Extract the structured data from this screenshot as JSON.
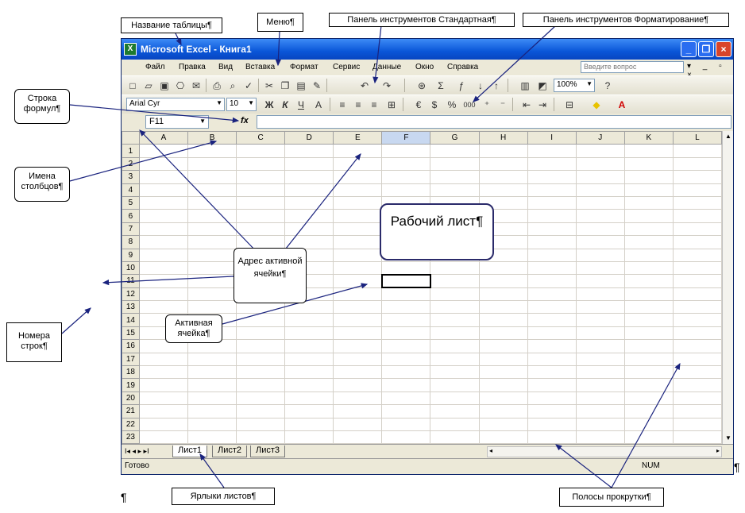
{
  "window": {
    "title": "Microsoft Excel - Книга1",
    "app_icon": "X",
    "min_label": "_",
    "max_label": "❐",
    "close_label": "×"
  },
  "menu": {
    "items": [
      "Файл",
      "Правка",
      "Вид",
      "Вставка",
      "Формат",
      "Сервис",
      "Данные",
      "Окно",
      "Справка"
    ],
    "help_placeholder": "Введите вопрос",
    "right_controls": "▾ _ ▫ ×"
  },
  "toolbar_standard": {
    "zoom": "100%"
  },
  "toolbar_format": {
    "font": "Arial Cyr",
    "size": "10",
    "bold": "Ж",
    "italic": "К",
    "underline": "Ч",
    "percent": "%",
    "thousands": "000"
  },
  "formula_bar": {
    "name_box": "F11",
    "fx": "fx",
    "value": ""
  },
  "sheet": {
    "columns": [
      "A",
      "B",
      "C",
      "D",
      "E",
      "F",
      "G",
      "H",
      "I",
      "J",
      "K",
      "L"
    ],
    "rows": [
      "1",
      "2",
      "3",
      "4",
      "5",
      "6",
      "7",
      "8",
      "9",
      "10",
      "11",
      "12",
      "13",
      "14",
      "15",
      "16",
      "17",
      "18",
      "19",
      "20",
      "21",
      "22",
      "23"
    ],
    "active_column": "F",
    "active_row": "11"
  },
  "tabs": {
    "nav": "I◂ ◂ ▸ ▸I",
    "sheets": [
      "Лист1",
      "Лист2",
      "Лист3"
    ],
    "active": "Лист1"
  },
  "status": {
    "text": "Готово",
    "num": "NUM"
  },
  "annotations": {
    "table_name": "Название таблицы¶",
    "menu": "Меню¶",
    "standard_toolbar": "Панель инструментов Стандартная¶",
    "format_toolbar": "Панель инструментов Форматирование¶",
    "formula_bar": "Строка формул¶",
    "column_names": "Имена столбцов¶",
    "worksheet": "Рабочий лист¶",
    "active_address": "Адрес активной ячейки¶",
    "active_cell": "Активная ячейка¶",
    "row_numbers": "Номера строк¶",
    "sheet_tabs": "Ярлыки листов¶",
    "scrollbars": "Полосы прокрутки¶",
    "pilcrow": "¶"
  }
}
